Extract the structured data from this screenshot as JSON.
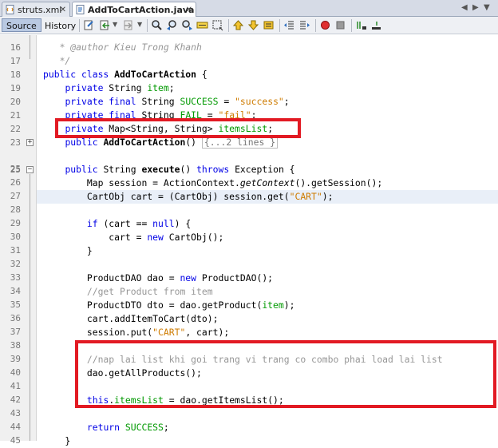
{
  "tabs": [
    {
      "label": "struts.xml",
      "active": false,
      "icon": "xml-file-icon"
    },
    {
      "label": "AddToCartAction.java",
      "active": true,
      "icon": "java-file-icon"
    }
  ],
  "toolbar": {
    "source_label": "Source",
    "history_label": "History",
    "icons": [
      "last-edit-icon",
      "back-icon",
      "forward-icon",
      "find-icon",
      "find-previous-icon",
      "find-next-icon",
      "toggle-highlight-icon",
      "toggle-rect-select-icon",
      "previous-bookmark-icon",
      "next-bookmark-icon",
      "toggle-bookmark-icon",
      "shift-left-icon",
      "shift-right-icon",
      "start-macro-icon",
      "stop-macro-icon",
      "comment-icon",
      "uncomment-icon"
    ]
  },
  "editor": {
    "lines": [
      {
        "n": "16",
        "t": "   * @author Kieu Trong Khanh"
      },
      {
        "n": "17",
        "t": "   */"
      },
      {
        "n": "18",
        "t": "public class AddToCartAction {"
      },
      {
        "n": "19",
        "t": "    private String item;"
      },
      {
        "n": "20",
        "t": "    private final String SUCCESS = \"success\";"
      },
      {
        "n": "21",
        "t": "    private final String FAIL = \"fail\";"
      },
      {
        "n": "22",
        "t": "    private Map<String, String> itemsList;"
      },
      {
        "n": "23",
        "t": "    public AddToCartAction() {...2 lines }"
      },
      {
        "n": "25",
        "t": ""
      },
      {
        "n": "26",
        "t": "    public String execute() throws Exception {"
      },
      {
        "n": "27",
        "t": "        Map session = ActionContext.getContext().getSession();"
      },
      {
        "n": "28",
        "t": "        CartObj cart = (CartObj) session.get(\"CART\");"
      },
      {
        "n": "29",
        "t": ""
      },
      {
        "n": "30",
        "t": "        if (cart == null) {"
      },
      {
        "n": "31",
        "t": "            cart = new CartObj();"
      },
      {
        "n": "32",
        "t": "        }"
      },
      {
        "n": "33",
        "t": ""
      },
      {
        "n": "34",
        "t": "        ProductDAO dao = new ProductDAO();"
      },
      {
        "n": "35",
        "t": "        //get Product from item"
      },
      {
        "n": "36",
        "t": "        ProductDTO dto = dao.getProduct(item);"
      },
      {
        "n": "37",
        "t": "        cart.addItemToCart(dto);"
      },
      {
        "n": "38",
        "t": "        session.put(\"CART\", cart);"
      },
      {
        "n": "39",
        "t": ""
      },
      {
        "n": "40",
        "t": "        //nap lai list khi goi trang vi trang co combo phai load lai list"
      },
      {
        "n": "41",
        "t": "        dao.getAllProducts();"
      },
      {
        "n": "42",
        "t": ""
      },
      {
        "n": "43",
        "t": "        this.itemsList = dao.getItemsList();"
      },
      {
        "n": "44",
        "t": ""
      },
      {
        "n": "45",
        "t": "        return SUCCESS;"
      },
      {
        "n": "46",
        "t": "    }"
      }
    ]
  },
  "annotation_color": "#e21a23"
}
